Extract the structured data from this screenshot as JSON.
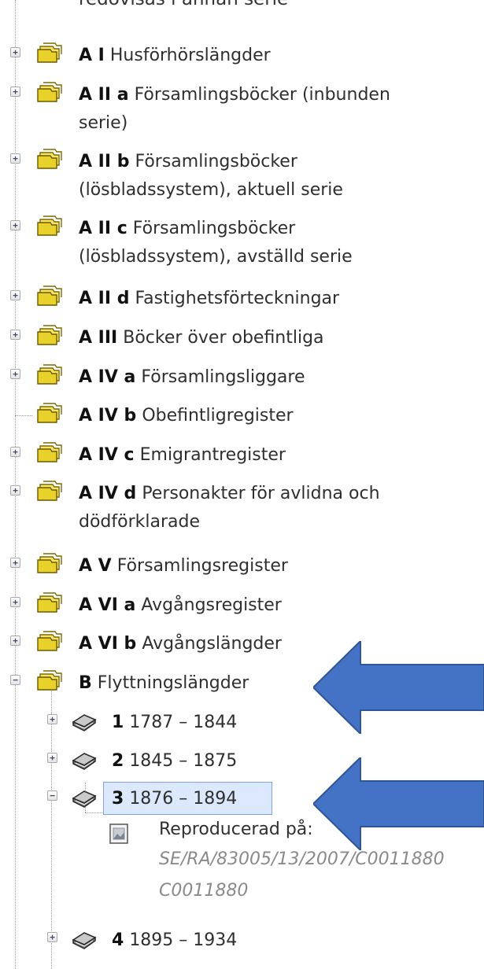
{
  "truncated_top_text": "redovisas i annan serie",
  "items": [
    {
      "code": "A I",
      "label": "Husförhörslängder",
      "expander": "+"
    },
    {
      "code": "A II a",
      "label": "Församlingsböcker (inbunden",
      "line2": "serie)",
      "expander": "+"
    },
    {
      "code": "A II b",
      "label": "Församlingsböcker",
      "line2": "(lösbladssystem), aktuell serie",
      "expander": "+"
    },
    {
      "code": "A II c",
      "label": "Församlingsböcker",
      "line2": "(lösbladssystem), avställd serie",
      "expander": "+"
    },
    {
      "code": "A II d",
      "label": "Fastighetsförteckningar",
      "expander": "+"
    },
    {
      "code": "A III",
      "label": "Böcker över obefintliga",
      "expander": "+"
    },
    {
      "code": "A IV a",
      "label": "Församlingsliggare",
      "expander": "+"
    },
    {
      "code": "A IV b",
      "label": "Obefintligregister",
      "expander": ""
    },
    {
      "code": "A IV c",
      "label": "Emigrantregister",
      "expander": "+"
    },
    {
      "code": "A IV d",
      "label": "Personakter för avlidna och",
      "line2": "dödförklarade",
      "expander": "+"
    },
    {
      "code": "A V",
      "label": "Församlingsregister",
      "expander": "+"
    },
    {
      "code": "A VI a",
      "label": "Avgångsregister",
      "expander": "+"
    },
    {
      "code": "A VI b",
      "label": "Avgångslängder",
      "expander": "+"
    },
    {
      "code": "B",
      "label": "Flyttningslängder",
      "expander": "−"
    }
  ],
  "volumes": [
    {
      "number": "1",
      "years": "1787 – 1844",
      "expander": "+"
    },
    {
      "number": "2",
      "years": "1845 – 1875",
      "expander": "+"
    },
    {
      "number": "3",
      "years": "1876 – 1894",
      "expander": "−",
      "selected": true
    },
    {
      "number": "4",
      "years": "1895 – 1934",
      "expander": "+"
    }
  ],
  "reproduction": {
    "label": "Reproducerad på:",
    "reference_1": "SE/RA/83005/13/2007/C0011880",
    "reference_2": "C0011880"
  },
  "colors": {
    "arrow_blue": "#4472c4",
    "selection_bg": "#dce8fb",
    "selection_border": "#7fa4da",
    "folder_yellow": "#e8d12a",
    "reference_gray": "#8a8a8a"
  },
  "icons": {
    "series": "stacked-yellow-folders-icon",
    "volume": "gray-book-icon",
    "reproduction": "image-file-icon",
    "expander": "plus-minus-toggle-icon",
    "annotation": "blue-arrow-left"
  }
}
